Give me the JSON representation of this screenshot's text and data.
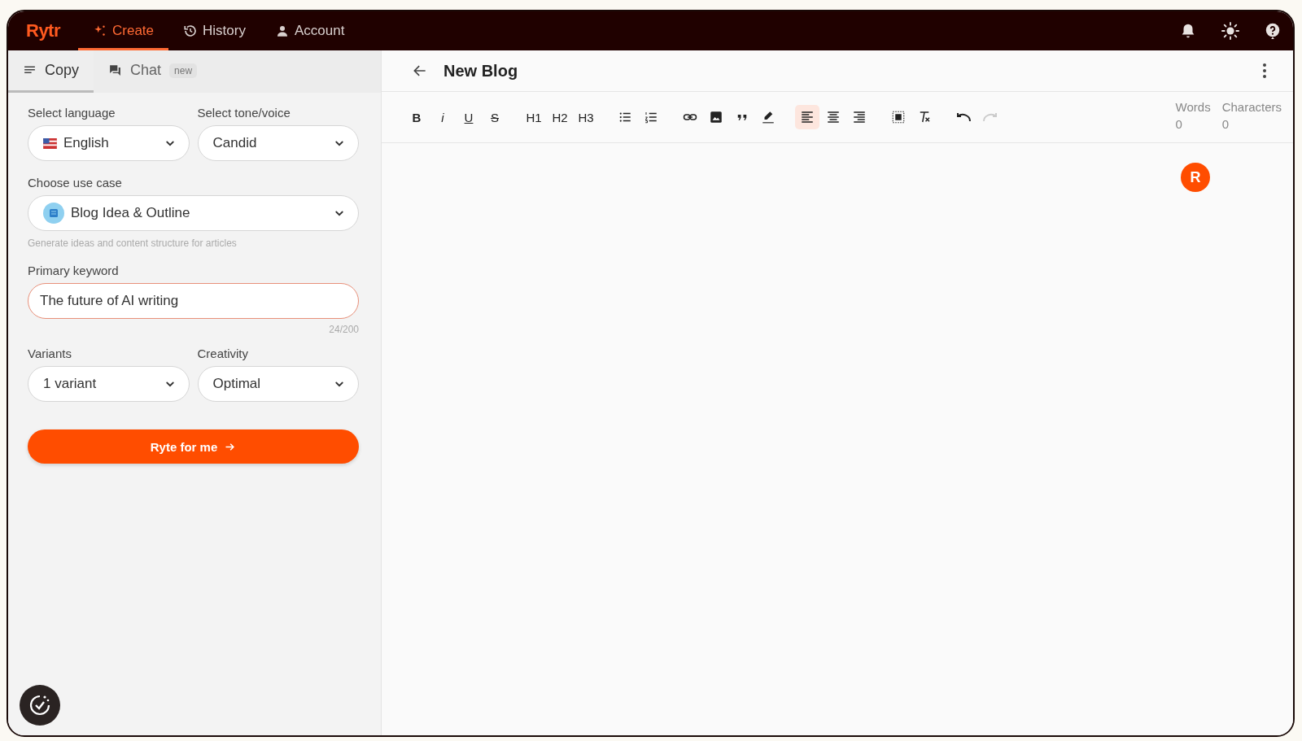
{
  "nav": {
    "logo": "Rytr",
    "items": [
      {
        "label": "Create",
        "selected": true
      },
      {
        "label": "History",
        "selected": false
      },
      {
        "label": "Account",
        "selected": false
      }
    ]
  },
  "panel_tabs": [
    {
      "label": "Copy",
      "selected": true
    },
    {
      "label": "Chat",
      "selected": false,
      "badge": "new"
    }
  ],
  "form": {
    "language": {
      "label": "Select language",
      "value": "English"
    },
    "tone": {
      "label": "Select tone/voice",
      "value": "Candid"
    },
    "use_case": {
      "label": "Choose use case",
      "value": "Blog Idea & Outline",
      "hint": "Generate ideas and content structure for articles"
    },
    "keyword": {
      "label": "Primary keyword",
      "value": "The future of AI writing",
      "counter": "24/200"
    },
    "variants": {
      "label": "Variants",
      "value": "1 variant"
    },
    "creativity": {
      "label": "Creativity",
      "value": "Optimal"
    },
    "submit": "Ryte for me"
  },
  "editor": {
    "title": "New Blog",
    "toolbar": [
      [
        {
          "label": "B"
        },
        {
          "label": "i"
        },
        {
          "label": "U"
        },
        {
          "label": "S"
        }
      ],
      [
        {
          "label": "H1"
        },
        {
          "label": "H2"
        },
        {
          "label": "H3"
        }
      ],
      [
        {
          "kind": "bullets"
        },
        {
          "kind": "numbers"
        }
      ],
      [
        {
          "kind": "link"
        },
        {
          "kind": "image"
        },
        {
          "kind": "quote"
        },
        {
          "kind": "highlight"
        }
      ],
      [
        {
          "kind": "align-left",
          "selected": true
        },
        {
          "kind": "align-center",
          "selected": false
        },
        {
          "kind": "align-right",
          "selected": false
        }
      ],
      [
        {
          "kind": "select-all"
        },
        {
          "kind": "clear-format"
        }
      ],
      [
        {
          "kind": "undo",
          "disabled": false
        },
        {
          "kind": "redo",
          "disabled": true
        }
      ]
    ],
    "stats": [
      {
        "label": "Words",
        "value": "0"
      },
      {
        "label": "Characters",
        "value": "0"
      }
    ],
    "avatar": "R"
  }
}
